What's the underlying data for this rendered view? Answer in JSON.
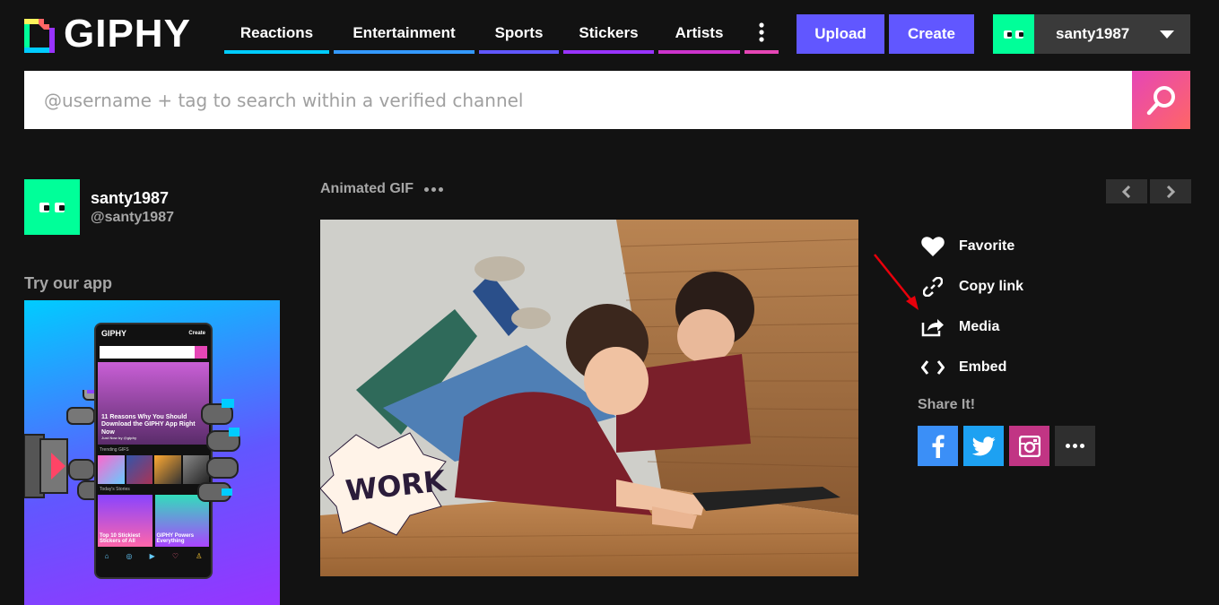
{
  "header": {
    "logo_text": "GIPHY",
    "nav": [
      {
        "label": "Reactions",
        "width": 117,
        "color": "#00ccff"
      },
      {
        "label": "Entertainment",
        "width": 157,
        "color": "#3399ff"
      },
      {
        "label": "Sports",
        "width": 89,
        "color": "#6157ff"
      },
      {
        "label": "Stickers",
        "width": 101,
        "color": "#9933ff"
      },
      {
        "label": "Artists",
        "width": 91,
        "color": "#cc33cc"
      }
    ],
    "upload_label": "Upload",
    "create_label": "Create",
    "username": "santy1987"
  },
  "search": {
    "placeholder": "@username + tag to search within a verified channel"
  },
  "profile": {
    "name": "santy1987",
    "handle": "@santy1987"
  },
  "sidebar": {
    "try_app": "Try our app",
    "phone": {
      "brand": "GIPHY",
      "create": "Create",
      "hero_text": "11 Reasons Why You Should Download the GIPHY App Right Now",
      "hero_sub": "Just Now by @giphy",
      "trending": "Trending GIFS",
      "stories": "Today's Stories",
      "story_1": "Top 10 Stickiest Stickers of All",
      "story_2": "GIPHY Powers Everything"
    }
  },
  "main": {
    "gif_type": "Animated GIF",
    "gif_sticker_text": "WORK"
  },
  "actions": [
    {
      "label": "Favorite",
      "icon": "heart-icon"
    },
    {
      "label": "Copy link",
      "icon": "link-icon"
    },
    {
      "label": "Media",
      "icon": "share-out-icon"
    },
    {
      "label": "Embed",
      "icon": "code-icon"
    }
  ],
  "share": {
    "title": "Share It!",
    "facebook_color": "#3b8ff7",
    "twitter_color": "#1da1f2",
    "instagram_color": "#c13584",
    "more_color": "#2f2f2f"
  },
  "colors": {
    "background": "#121212",
    "accent": "#6157ff",
    "avatar": "#00ff99"
  }
}
